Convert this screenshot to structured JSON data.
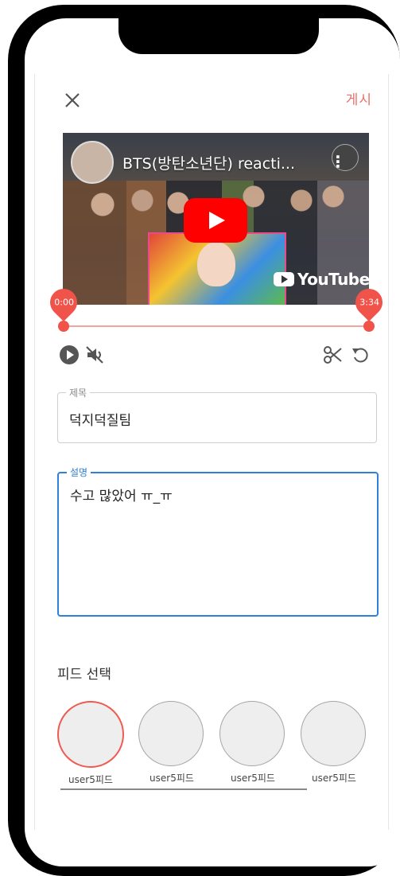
{
  "header": {
    "close_icon": "close-icon",
    "post_label": "게시"
  },
  "video": {
    "title": "BTS(방탄소년단) reacti...",
    "brand": "YouTube",
    "play_icon": "youtube-play-icon"
  },
  "trim": {
    "start": "0:00",
    "end": "3:34"
  },
  "controls": {
    "play_icon": "play-circle-icon",
    "mute_icon": "muted-speaker-icon",
    "cut_icon": "scissors-icon",
    "reset_icon": "undo-icon"
  },
  "title_field": {
    "label": "제목",
    "value": "덕지덕질팀"
  },
  "description_field": {
    "label": "설명",
    "value": "수고 많았어 ㅠ_ㅠ"
  },
  "feed": {
    "title": "피드 선택",
    "items": [
      {
        "name": "user5피드",
        "selected": true
      },
      {
        "name": "user5피드",
        "selected": false
      },
      {
        "name": "user5피드",
        "selected": false
      },
      {
        "name": "user5피드",
        "selected": false
      }
    ]
  },
  "colors": {
    "accent": "#f0534a",
    "focus": "#2f80d8",
    "post": "#e8726b"
  }
}
